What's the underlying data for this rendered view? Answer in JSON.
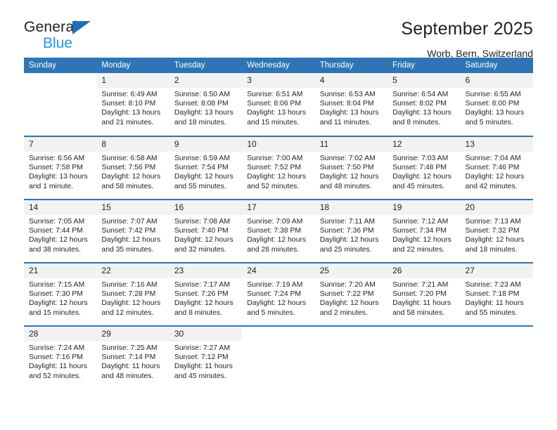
{
  "brand": {
    "line1": "General",
    "line2": "Blue",
    "triangle_icon": "triangle-icon",
    "accent_dark": "#1f6fb5",
    "accent_light": "#2196e3"
  },
  "header": {
    "title": "September 2025",
    "subtitle": "Worb, Bern, Switzerland"
  },
  "theme": {
    "header_blue": "#2e75b6",
    "daynum_band": "#f2f2f2",
    "text": "#231f20"
  },
  "calendar": {
    "weekday_headers": [
      "Sunday",
      "Monday",
      "Tuesday",
      "Wednesday",
      "Thursday",
      "Friday",
      "Saturday"
    ],
    "weeks": [
      [
        {
          "empty": true
        },
        {
          "day": "1",
          "sunrise": "Sunrise: 6:49 AM",
          "sunset": "Sunset: 8:10 PM",
          "daylight": "Daylight: 13 hours and 21 minutes."
        },
        {
          "day": "2",
          "sunrise": "Sunrise: 6:50 AM",
          "sunset": "Sunset: 8:08 PM",
          "daylight": "Daylight: 13 hours and 18 minutes."
        },
        {
          "day": "3",
          "sunrise": "Sunrise: 6:51 AM",
          "sunset": "Sunset: 8:06 PM",
          "daylight": "Daylight: 13 hours and 15 minutes."
        },
        {
          "day": "4",
          "sunrise": "Sunrise: 6:53 AM",
          "sunset": "Sunset: 8:04 PM",
          "daylight": "Daylight: 13 hours and 11 minutes."
        },
        {
          "day": "5",
          "sunrise": "Sunrise: 6:54 AM",
          "sunset": "Sunset: 8:02 PM",
          "daylight": "Daylight: 13 hours and 8 minutes."
        },
        {
          "day": "6",
          "sunrise": "Sunrise: 6:55 AM",
          "sunset": "Sunset: 8:00 PM",
          "daylight": "Daylight: 13 hours and 5 minutes."
        }
      ],
      [
        {
          "day": "7",
          "sunrise": "Sunrise: 6:56 AM",
          "sunset": "Sunset: 7:58 PM",
          "daylight": "Daylight: 13 hours and 1 minute."
        },
        {
          "day": "8",
          "sunrise": "Sunrise: 6:58 AM",
          "sunset": "Sunset: 7:56 PM",
          "daylight": "Daylight: 12 hours and 58 minutes."
        },
        {
          "day": "9",
          "sunrise": "Sunrise: 6:59 AM",
          "sunset": "Sunset: 7:54 PM",
          "daylight": "Daylight: 12 hours and 55 minutes."
        },
        {
          "day": "10",
          "sunrise": "Sunrise: 7:00 AM",
          "sunset": "Sunset: 7:52 PM",
          "daylight": "Daylight: 12 hours and 52 minutes."
        },
        {
          "day": "11",
          "sunrise": "Sunrise: 7:02 AM",
          "sunset": "Sunset: 7:50 PM",
          "daylight": "Daylight: 12 hours and 48 minutes."
        },
        {
          "day": "12",
          "sunrise": "Sunrise: 7:03 AM",
          "sunset": "Sunset: 7:48 PM",
          "daylight": "Daylight: 12 hours and 45 minutes."
        },
        {
          "day": "13",
          "sunrise": "Sunrise: 7:04 AM",
          "sunset": "Sunset: 7:46 PM",
          "daylight": "Daylight: 12 hours and 42 minutes."
        }
      ],
      [
        {
          "day": "14",
          "sunrise": "Sunrise: 7:05 AM",
          "sunset": "Sunset: 7:44 PM",
          "daylight": "Daylight: 12 hours and 38 minutes."
        },
        {
          "day": "15",
          "sunrise": "Sunrise: 7:07 AM",
          "sunset": "Sunset: 7:42 PM",
          "daylight": "Daylight: 12 hours and 35 minutes."
        },
        {
          "day": "16",
          "sunrise": "Sunrise: 7:08 AM",
          "sunset": "Sunset: 7:40 PM",
          "daylight": "Daylight: 12 hours and 32 minutes."
        },
        {
          "day": "17",
          "sunrise": "Sunrise: 7:09 AM",
          "sunset": "Sunset: 7:38 PM",
          "daylight": "Daylight: 12 hours and 28 minutes."
        },
        {
          "day": "18",
          "sunrise": "Sunrise: 7:11 AM",
          "sunset": "Sunset: 7:36 PM",
          "daylight": "Daylight: 12 hours and 25 minutes."
        },
        {
          "day": "19",
          "sunrise": "Sunrise: 7:12 AM",
          "sunset": "Sunset: 7:34 PM",
          "daylight": "Daylight: 12 hours and 22 minutes."
        },
        {
          "day": "20",
          "sunrise": "Sunrise: 7:13 AM",
          "sunset": "Sunset: 7:32 PM",
          "daylight": "Daylight: 12 hours and 18 minutes."
        }
      ],
      [
        {
          "day": "21",
          "sunrise": "Sunrise: 7:15 AM",
          "sunset": "Sunset: 7:30 PM",
          "daylight": "Daylight: 12 hours and 15 minutes."
        },
        {
          "day": "22",
          "sunrise": "Sunrise: 7:16 AM",
          "sunset": "Sunset: 7:28 PM",
          "daylight": "Daylight: 12 hours and 12 minutes."
        },
        {
          "day": "23",
          "sunrise": "Sunrise: 7:17 AM",
          "sunset": "Sunset: 7:26 PM",
          "daylight": "Daylight: 12 hours and 8 minutes."
        },
        {
          "day": "24",
          "sunrise": "Sunrise: 7:19 AM",
          "sunset": "Sunset: 7:24 PM",
          "daylight": "Daylight: 12 hours and 5 minutes."
        },
        {
          "day": "25",
          "sunrise": "Sunrise: 7:20 AM",
          "sunset": "Sunset: 7:22 PM",
          "daylight": "Daylight: 12 hours and 2 minutes."
        },
        {
          "day": "26",
          "sunrise": "Sunrise: 7:21 AM",
          "sunset": "Sunset: 7:20 PM",
          "daylight": "Daylight: 11 hours and 58 minutes."
        },
        {
          "day": "27",
          "sunrise": "Sunrise: 7:23 AM",
          "sunset": "Sunset: 7:18 PM",
          "daylight": "Daylight: 11 hours and 55 minutes."
        }
      ],
      [
        {
          "day": "28",
          "sunrise": "Sunrise: 7:24 AM",
          "sunset": "Sunset: 7:16 PM",
          "daylight": "Daylight: 11 hours and 52 minutes."
        },
        {
          "day": "29",
          "sunrise": "Sunrise: 7:25 AM",
          "sunset": "Sunset: 7:14 PM",
          "daylight": "Daylight: 11 hours and 48 minutes."
        },
        {
          "day": "30",
          "sunrise": "Sunrise: 7:27 AM",
          "sunset": "Sunset: 7:12 PM",
          "daylight": "Daylight: 11 hours and 45 minutes."
        },
        {
          "empty": true
        },
        {
          "empty": true
        },
        {
          "empty": true
        },
        {
          "empty": true
        }
      ]
    ]
  }
}
